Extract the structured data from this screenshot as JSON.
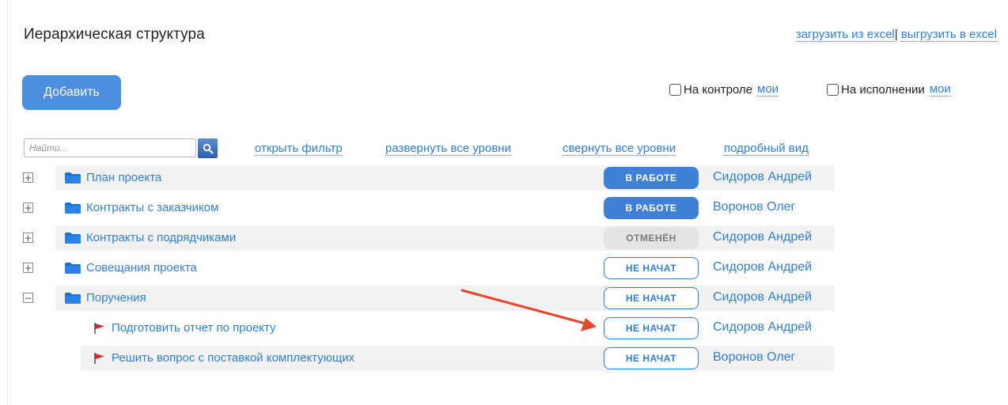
{
  "header": {
    "title": "Иерархическая структура",
    "excel_import": "загрузить из excel",
    "excel_sep": "|",
    "excel_export": "выгрузить в excel"
  },
  "actions": {
    "add_label": "Добавить"
  },
  "filters": {
    "on_control": {
      "label": "На контроле",
      "mine": "мои",
      "checked": false
    },
    "on_execution": {
      "label": "На исполнении",
      "mine": "мои",
      "checked": false
    }
  },
  "search": {
    "placeholder": "Найти..."
  },
  "toolbar": {
    "open_filter": "открыть фильтр",
    "expand_all": "развернуть все уровни",
    "collapse_all": "свернуть все уровни",
    "detailed_view": "подробный вид"
  },
  "tree": [
    {
      "label": "План проекта",
      "type": "folder",
      "toggle": "+",
      "status": "В РАБОТЕ",
      "assignee": "Сидоров Андрей"
    },
    {
      "label": "Контракты с заказчиком",
      "type": "folder",
      "toggle": "+",
      "status": "В РАБОТЕ",
      "assignee": "Воронов Олег"
    },
    {
      "label": "Контракты с подрядчиками",
      "type": "folder",
      "toggle": "+",
      "status": "ОТМЕНЁН",
      "assignee": "Сидоров Андрей"
    },
    {
      "label": "Совещания проекта",
      "type": "folder",
      "toggle": "+",
      "status": "НЕ НАЧАТ",
      "assignee": "Сидоров Андрей"
    },
    {
      "label": "Поручения",
      "type": "folder",
      "toggle": "−",
      "status": "НЕ НАЧАТ",
      "assignee": "Сидоров Андрей"
    },
    {
      "label": "Подготовить отчет по проекту",
      "type": "task",
      "status": "НЕ НАЧАТ",
      "assignee": "Сидоров Андрей"
    },
    {
      "label": "Решить вопрос с поставкой комплектующих",
      "type": "task",
      "status": "НЕ НАЧАТ",
      "assignee": "Воронов Олег"
    }
  ],
  "colors": {
    "link": "#2f7fd6",
    "button": "#4a8fe0",
    "status_in_progress": "#3f81d6",
    "status_cancelled": "#e4e4e4",
    "annotation_arrow": "#e8442a"
  }
}
